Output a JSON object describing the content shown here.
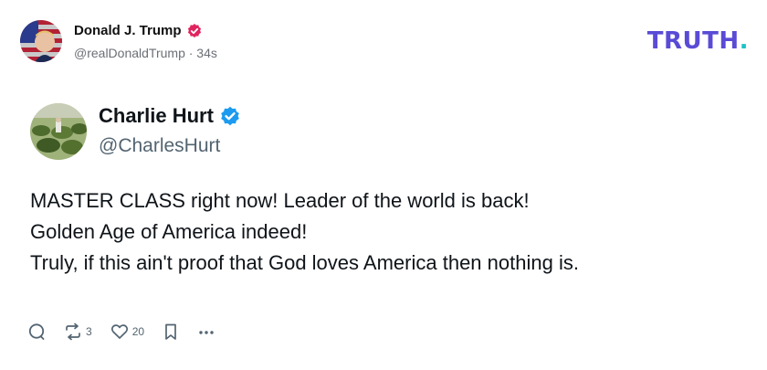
{
  "post": {
    "author_name": "Donald J. Trump",
    "author_handle": "@realDonaldTrump · 34s",
    "platform_logo": "TRUTH",
    "platform_logo_dot": ".",
    "verified_color": "#e0245e",
    "quoted": {
      "name": "Charlie Hurt",
      "handle": "@CharlesHurt",
      "verified_color": "#1d9bf0",
      "lines": [
        "MASTER CLASS right now! Leader of the world is back!",
        "Golden Age of America indeed!",
        "Truly, if this ain't proof that God loves America then nothing is."
      ]
    },
    "actions": {
      "reply_icon": "reply-icon",
      "retweet_count": "3",
      "like_count": "20",
      "bookmark_icon": "bookmark-icon",
      "more_icon": "more-icon"
    }
  },
  "colors": {
    "logo_purple": "#5a4bd6",
    "logo_teal": "#19c3c8",
    "meta_gray": "#6b6f76"
  }
}
